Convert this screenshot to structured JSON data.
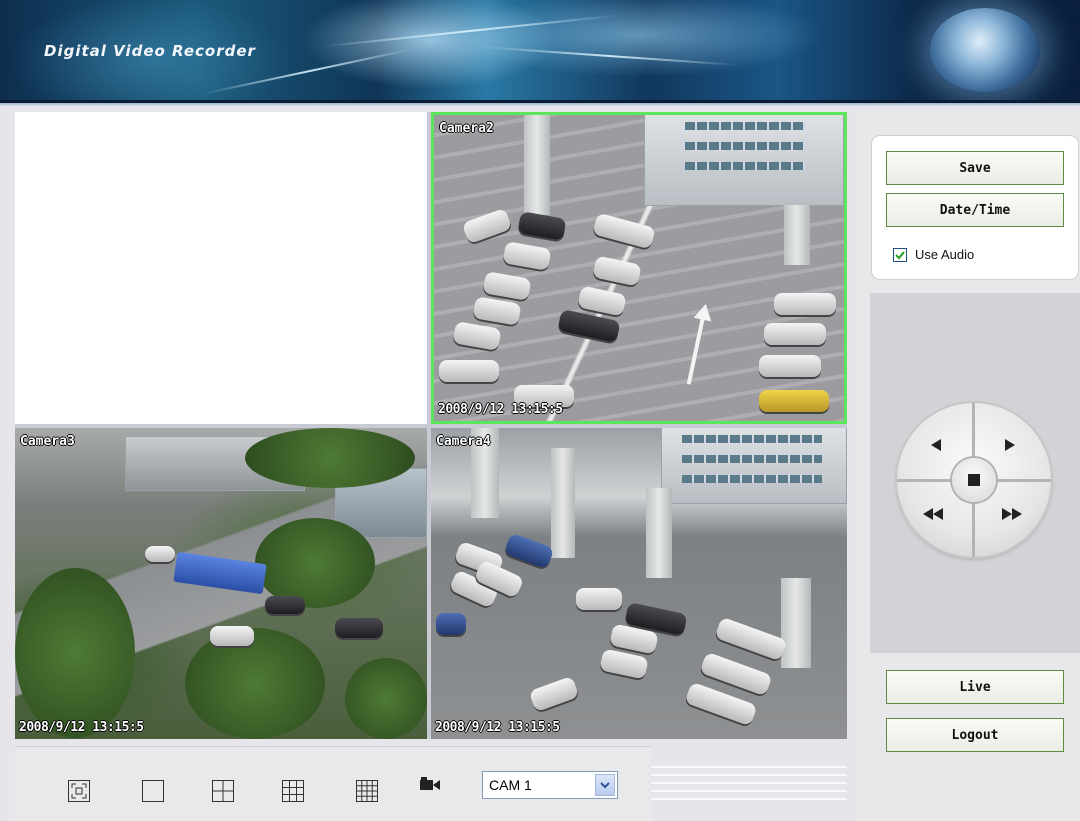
{
  "header": {
    "title": "Digital Video Recorder"
  },
  "cameras": [
    {
      "label": "",
      "timestamp": ""
    },
    {
      "label": "Camera2",
      "timestamp": "2008/9/12 13:15:5"
    },
    {
      "label": "Camera3",
      "timestamp": "2008/9/12 13:15:5"
    },
    {
      "label": "Camera4",
      "timestamp": "2008/9/12 13:15:5"
    }
  ],
  "toolbar": {
    "buttons": [
      "fullscreen-icon",
      "single-view-icon",
      "quad-view-icon",
      "nine-view-icon",
      "sixteen-view-icon",
      "camera-icon"
    ],
    "camera_select": {
      "value": "CAM 1"
    }
  },
  "panel": {
    "save_label": "Save",
    "datetime_label": "Date/Time",
    "audio_label": "Use Audio",
    "audio_checked": true,
    "live_label": "Live",
    "logout_label": "Logout"
  },
  "colors": {
    "active_border": "#5ee65a",
    "button_border": "#5e8b44"
  }
}
